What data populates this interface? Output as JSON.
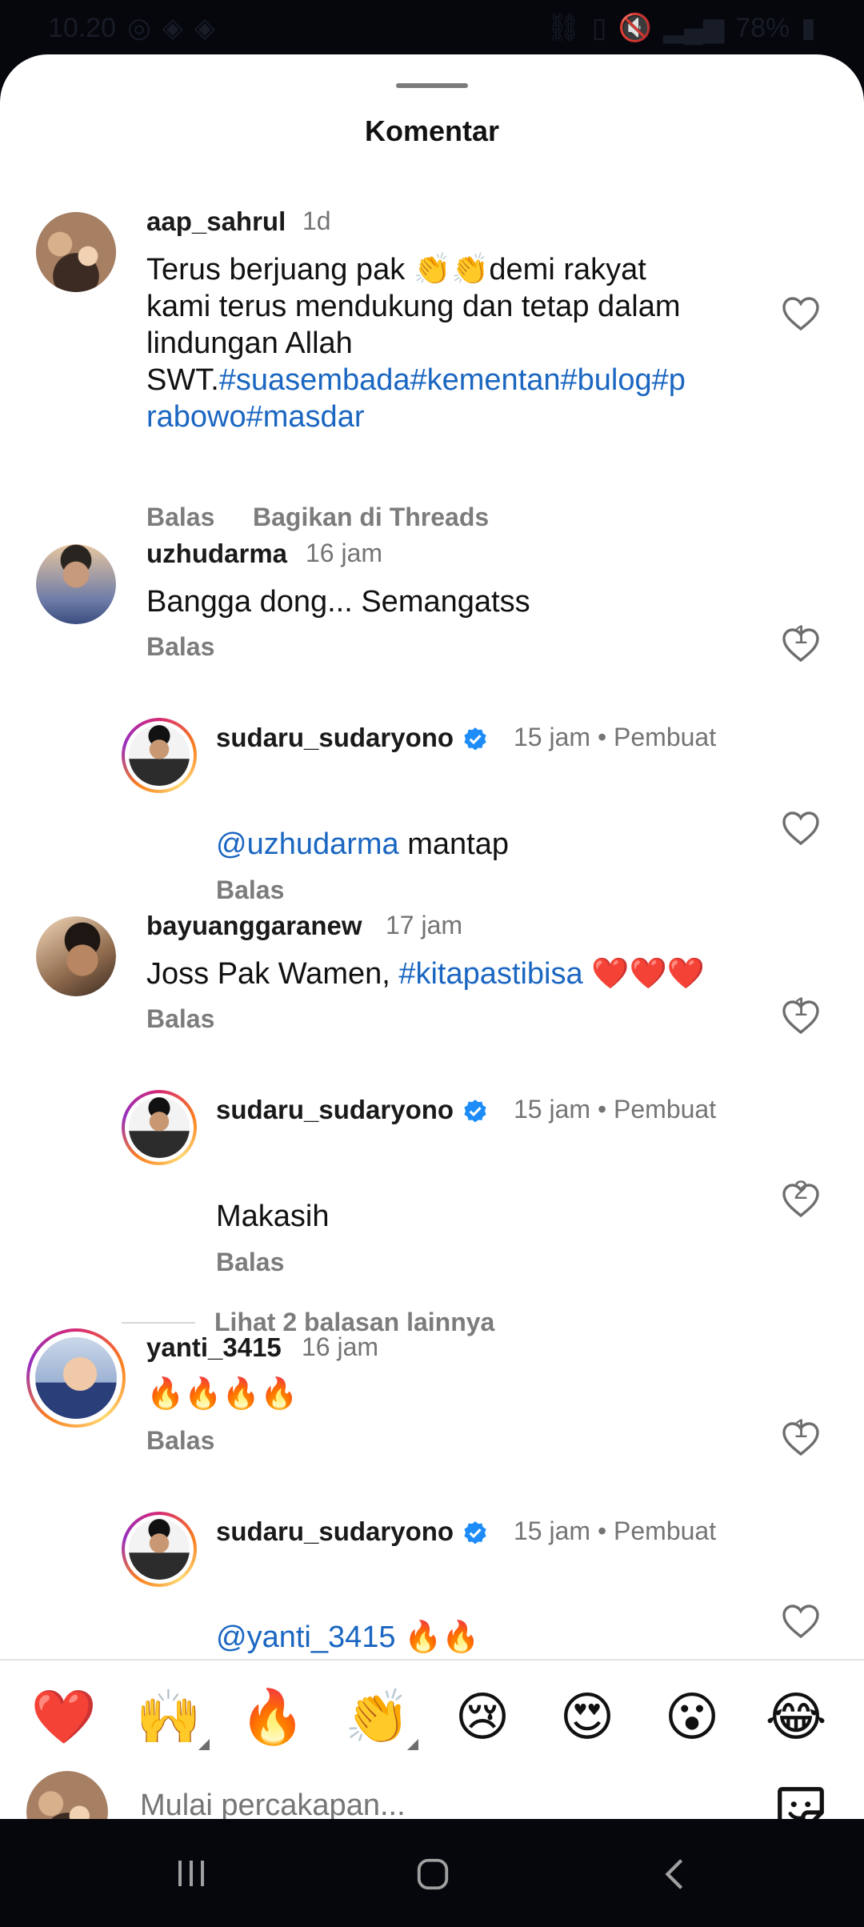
{
  "status": {
    "time": "10.20",
    "battery": "78%"
  },
  "sheet": {
    "title": "Komentar"
  },
  "comments": [
    {
      "username": "aap_sahrul",
      "time": "1d",
      "text_parts": [
        "Terus berjuang pak 👏👏demi rakyat",
        "kami terus mendukung dan tetap dalam",
        "lindungan Allah",
        "SWT."
      ],
      "hashtags_line1": "#suasembada#kementan#bulog#p",
      "hashtags_line2": "rabowo#masdar",
      "reply": "Balas",
      "share": "Bagikan di Threads"
    },
    {
      "username": "uzhudarma",
      "time": "16 jam",
      "text": "Bangga dong... Semangatss",
      "reply": "Balas",
      "likes": "1"
    },
    {
      "username": "sudaru_sudaryono",
      "time": "15 jam",
      "creator": "Pembuat",
      "mention": "uzhudarma",
      "text": " mantap",
      "reply": "Balas"
    },
    {
      "username": "bayuanggaranew",
      "time": "17 jam",
      "text": "Joss Pak Wamen, ",
      "hashtag": "#kitapastibisa",
      "emojis": " ❤️❤️❤️",
      "reply": "Balas",
      "likes": "1"
    },
    {
      "username": "sudaru_sudaryono",
      "time": "15 jam",
      "creator": "Pembuat",
      "text": "Makasih",
      "reply": "Balas",
      "likes": "2"
    },
    {
      "more_replies": "Lihat 2 balasan lainnya"
    },
    {
      "username": "yanti_3415",
      "time": "16 jam",
      "text": "🔥🔥🔥🔥",
      "reply": "Balas",
      "likes": "1"
    },
    {
      "username": "sudaru_sudaryono",
      "time": "15 jam",
      "creator": "Pembuat",
      "mention": "yanti_3415",
      "text": " 🔥🔥"
    }
  ],
  "emoji_bar": [
    "❤️",
    "🙌",
    "🔥",
    "👏",
    "😢",
    "😍",
    "😮",
    "😂"
  ],
  "composer": {
    "placeholder": "Mulai percakapan..."
  },
  "icons": {
    "heart": "heart-outline-icon",
    "verified": "verified-badge-icon",
    "sticker": "sticker-icon"
  },
  "colors": {
    "link": "#1a66c1",
    "verified": "#1d8cf8"
  }
}
